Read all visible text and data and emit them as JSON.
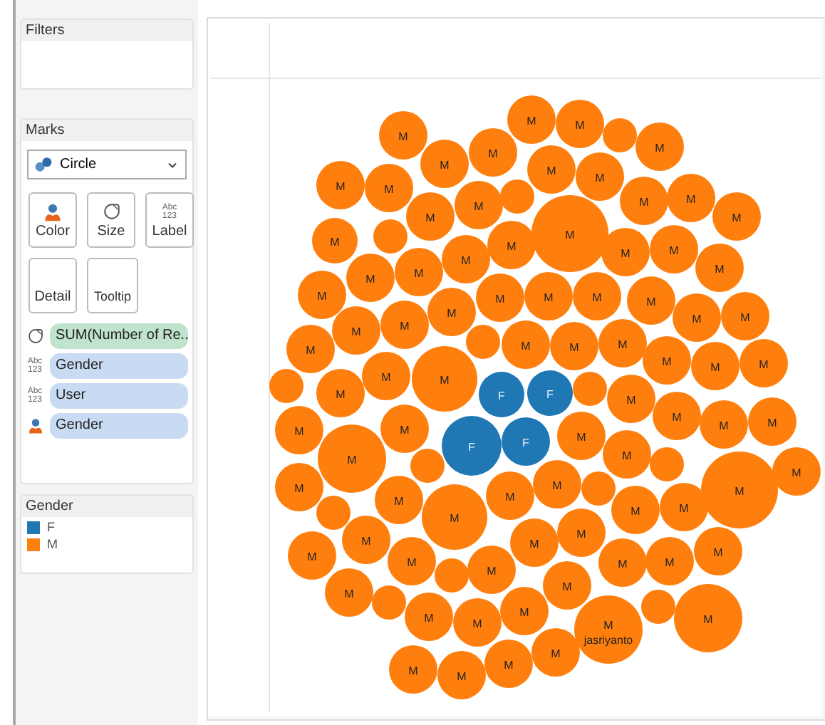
{
  "filters": {
    "title": "Filters"
  },
  "marks": {
    "title": "Marks",
    "mark_type": "Circle",
    "cards": [
      {
        "kind": "color",
        "label": "Color"
      },
      {
        "kind": "size",
        "label": "Size"
      },
      {
        "kind": "label",
        "label": "Label",
        "icon_text": [
          "Abc",
          "123"
        ]
      },
      {
        "kind": "detail",
        "label": "Detail"
      },
      {
        "kind": "tooltip",
        "label": "Tooltip"
      }
    ],
    "shelf": [
      {
        "kind": "size",
        "label": "SUM(Number of Re..",
        "color": "#bfe3cc"
      },
      {
        "kind": "label",
        "label": "Gender",
        "color": "#c9dbf3",
        "icon_text": [
          "Abc",
          "123"
        ]
      },
      {
        "kind": "label",
        "label": "User",
        "color": "#c9dbf3",
        "icon_text": [
          "Abc",
          "123"
        ]
      },
      {
        "kind": "color",
        "label": "Gender",
        "color": "#c9dbf3"
      }
    ]
  },
  "legend": {
    "title": "Gender",
    "items": [
      {
        "label": "F",
        "color": "#1f77b4"
      },
      {
        "label": "M",
        "color": "#ff7f0e"
      }
    ]
  },
  "bubbles": [
    {
      "label": "M",
      "color": "#ff7f0e"
    },
    {
      "label": "M",
      "color": "#ff7f0e"
    },
    {
      "label": "M",
      "color": "#ff7f0e"
    },
    {
      "label": "M",
      "color": "#ff7f0e"
    },
    {
      "label": "M",
      "color": "#ff7f0e"
    },
    {
      "color": "#ff7f0e"
    },
    {
      "label": "M",
      "color": "#ff7f0e"
    },
    {
      "label": "M",
      "color": "#ff7f0e"
    },
    {
      "label": "M",
      "color": "#ff7f0e"
    },
    {
      "label": "M",
      "color": "#ff7f0e"
    },
    {
      "label": "M",
      "color": "#ff7f0e"
    },
    {
      "label": "M",
      "color": "#ff7f0e"
    },
    {
      "label": "M",
      "color": "#ff7f0e"
    },
    {
      "color": "#ff7f0e"
    },
    {
      "label": "M",
      "color": "#ff7f0e"
    },
    {
      "label": "M",
      "color": "#ff7f0e"
    },
    {
      "label": "M",
      "color": "#ff7f0e"
    },
    {
      "label": "M",
      "color": "#ff7f0e"
    },
    {
      "label": "M",
      "color": "#ff7f0e"
    },
    {
      "color": "#ff7f0e"
    },
    {
      "label": "M",
      "color": "#ff7f0e"
    },
    {
      "label": "M",
      "color": "#ff7f0e"
    },
    {
      "label": "M",
      "color": "#ff7f0e"
    },
    {
      "label": "M",
      "color": "#ff7f0e"
    },
    {
      "label": "M",
      "color": "#ff7f0e"
    },
    {
      "label": "M",
      "color": "#ff7f0e"
    },
    {
      "label": "M",
      "color": "#ff7f0e"
    },
    {
      "label": "M",
      "color": "#ff7f0e"
    },
    {
      "label": "M",
      "color": "#ff7f0e"
    },
    {
      "label": "M",
      "color": "#ff7f0e"
    },
    {
      "label": "M",
      "color": "#ff7f0e"
    },
    {
      "label": "M",
      "color": "#ff7f0e"
    },
    {
      "label": "M",
      "color": "#ff7f0e"
    },
    {
      "label": "M",
      "color": "#ff7f0e"
    },
    {
      "label": "M",
      "color": "#ff7f0e"
    },
    {
      "label": "M",
      "color": "#ff7f0e"
    },
    {
      "label": "M",
      "color": "#ff7f0e"
    },
    {
      "label": "M",
      "color": "#ff7f0e"
    },
    {
      "color": "#ff7f0e"
    },
    {
      "label": "M",
      "color": "#ff7f0e"
    },
    {
      "label": "M",
      "color": "#ff7f0e"
    },
    {
      "label": "M",
      "color": "#ff7f0e"
    },
    {
      "label": "M",
      "color": "#ff7f0e"
    },
    {
      "label": "M",
      "color": "#ff7f0e"
    },
    {
      "label": "M",
      "color": "#ff7f0e"
    },
    {
      "color": "#ff7f0e"
    },
    {
      "label": "M",
      "color": "#ff7f0e"
    },
    {
      "label": "M",
      "color": "#ff7f0e"
    },
    {
      "label": "M",
      "color": "#ff7f0e"
    },
    {
      "label": "F",
      "color": "#1f77b4"
    },
    {
      "label": "F",
      "color": "#1f77b4"
    },
    {
      "color": "#ff7f0e"
    },
    {
      "label": "M",
      "color": "#ff7f0e"
    },
    {
      "label": "M",
      "color": "#ff7f0e"
    },
    {
      "label": "M",
      "color": "#ff7f0e"
    },
    {
      "label": "M",
      "color": "#ff7f0e"
    },
    {
      "label": "M",
      "color": "#ff7f0e"
    },
    {
      "label": "M",
      "color": "#ff7f0e"
    },
    {
      "label": "M",
      "color": "#ff7f0e"
    },
    {
      "label": "F",
      "color": "#1f77b4"
    },
    {
      "label": "F",
      "color": "#1f77b4"
    },
    {
      "label": "M",
      "color": "#ff7f0e"
    },
    {
      "label": "M",
      "color": "#ff7f0e"
    },
    {
      "color": "#ff7f0e"
    },
    {
      "label": "M",
      "color": "#ff7f0e"
    },
    {
      "label": "M",
      "color": "#ff7f0e"
    },
    {
      "label": "M",
      "color": "#ff7f0e"
    },
    {
      "color": "#ff7f0e"
    },
    {
      "color": "#ff7f0e"
    },
    {
      "label": "M",
      "color": "#ff7f0e"
    },
    {
      "label": "M",
      "color": "#ff7f0e"
    },
    {
      "label": "M",
      "color": "#ff7f0e"
    },
    {
      "label": "M",
      "color": "#ff7f0e"
    },
    {
      "color": "#ff7f0e"
    },
    {
      "label": "M",
      "color": "#ff7f0e"
    },
    {
      "label": "M",
      "color": "#ff7f0e"
    },
    {
      "label": "M",
      "color": "#ff7f0e"
    },
    {
      "label": "M",
      "color": "#ff7f0e"
    },
    {
      "label": "M",
      "color": "#ff7f0e"
    },
    {
      "color": "#ff7f0e"
    },
    {
      "label": "M",
      "color": "#ff7f0e"
    },
    {
      "label": "M",
      "color": "#ff7f0e"
    },
    {
      "label": "M",
      "color": "#ff7f0e"
    },
    {
      "label": "M",
      "color": "#ff7f0e"
    },
    {
      "label": "M",
      "color": "#ff7f0e"
    },
    {
      "label": "M",
      "color": "#ff7f0e"
    },
    {
      "label": "M",
      "color": "#ff7f0e"
    },
    {
      "color": "#ff7f0e"
    },
    {
      "label": "M",
      "color": "#ff7f0e"
    },
    {
      "label": "M",
      "color": "#ff7f0e"
    },
    {
      "label": "M",
      "color": "#ff7f0e"
    },
    {
      "label": "M",
      "color": "#ff7f0e"
    },
    {
      "label": "M",
      "sublabel": "jasriyanto",
      "color": "#ff7f0e"
    },
    {
      "color": "#ff7f0e"
    },
    {
      "label": "M",
      "color": "#ff7f0e"
    },
    {
      "label": "M",
      "color": "#ff7f0e"
    },
    {
      "label": "M",
      "color": "#ff7f0e"
    },
    {
      "label": "M",
      "color": "#ff7f0e"
    },
    {
      "label": "M",
      "color": "#ff7f0e"
    }
  ]
}
